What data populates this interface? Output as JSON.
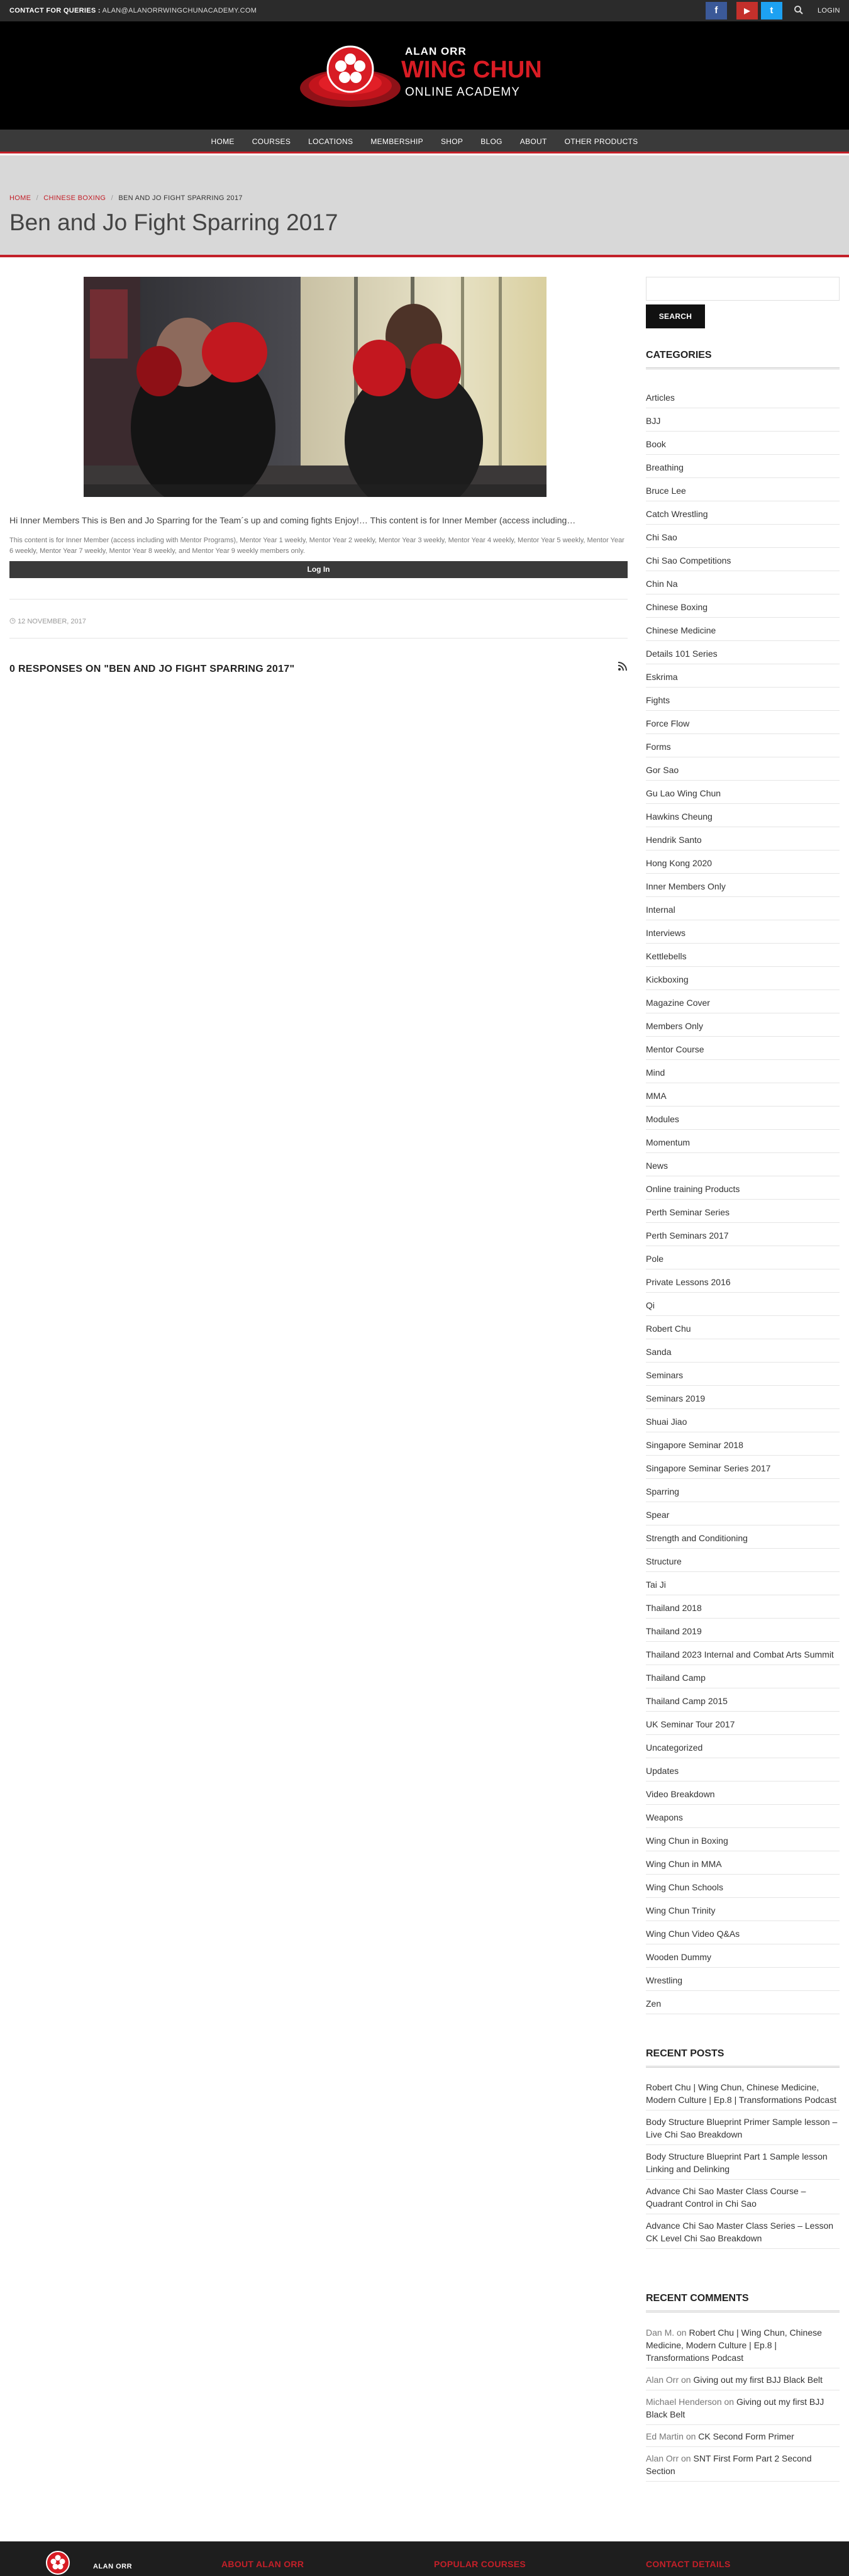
{
  "topbar": {
    "contact_label": "CONTACT FOR QUERIES :",
    "contact_email": "ALAN@ALANORRWINGCHUNACADEMY.COM",
    "facebook_glyph": "f",
    "youtube_glyph": "▶",
    "twitter_glyph": "t",
    "login_label": "LOGIN"
  },
  "logo": {
    "line1": "ALAN ORR",
    "line2": "WING CHUN",
    "line3": "ONLINE ACADEMY"
  },
  "nav": {
    "items": [
      "HOME",
      "COURSES",
      "LOCATIONS",
      "MEMBERSHIP",
      "SHOP",
      "BLOG",
      "ABOUT",
      "OTHER PRODUCTS"
    ]
  },
  "breadcrumb": {
    "home": "HOME",
    "category": "CHINESE BOXING",
    "current": "BEN AND JO FIGHT SPARRING 2017",
    "separator": "/"
  },
  "page_title": "Ben and Jo Fight Sparring 2017",
  "post": {
    "excerpt": "Hi Inner Members This is Ben and Jo Sparring for the Team´s up and coming fights Enjoy!… This content is for Inner Member (access including…",
    "notice": "This content is for Inner Member (access including with Mentor Programs), Mentor Year 1 weekly, Mentor Year 2 weekly, Mentor Year 3 weekly, Mentor Year 4 weekly, Mentor Year 5 weekly, Mentor Year 6 weekly, Mentor Year 7 weekly, Mentor Year 8 weekly, and Mentor Year 9 weekly members only.",
    "login_button": "Log In",
    "date": "12 NOVEMBER, 2017",
    "responses": "0 RESPONSES ON \"BEN AND JO FIGHT SPARRING 2017\""
  },
  "sidebar": {
    "search_placeholder": "",
    "search_button": "SEARCH",
    "categories_heading": "CATEGORIES",
    "categories": [
      "Articles",
      "BJJ",
      "Book",
      "Breathing",
      "Bruce Lee",
      "Catch Wrestling",
      "Chi Sao",
      "Chi Sao Competitions",
      "Chin Na",
      "Chinese Boxing",
      "Chinese Medicine",
      "Details 101 Series",
      "Eskrima",
      "Fights",
      "Force Flow",
      "Forms",
      "Gor Sao",
      "Gu Lao Wing Chun",
      "Hawkins Cheung",
      "Hendrik Santo",
      "Hong Kong 2020",
      "Inner Members Only",
      "Internal",
      "Interviews",
      "Kettlebells",
      "Kickboxing",
      "Magazine Cover",
      "Members Only",
      "Mentor Course",
      "Mind",
      "MMA",
      "Modules",
      "Momentum",
      "News",
      "Online training Products",
      "Perth Seminar Series",
      "Perth Seminars 2017",
      "Pole",
      "Private Lessons 2016",
      "Qi",
      "Robert Chu",
      "Sanda",
      "Seminars",
      "Seminars 2019",
      "Shuai Jiao",
      "Singapore Seminar 2018",
      "Singapore Seminar Series 2017",
      "Sparring",
      "Spear",
      "Strength and Conditioning",
      "Structure",
      "Tai Ji",
      "Thailand 2018",
      "Thailand 2019",
      "Thailand 2023 Internal and Combat Arts Summit",
      "Thailand Camp",
      "Thailand Camp 2015",
      "UK Seminar Tour 2017",
      "Uncategorized",
      "Updates",
      "Video Breakdown",
      "Weapons",
      "Wing Chun in Boxing",
      "Wing Chun in MMA",
      "Wing Chun Schools",
      "Wing Chun Trinity",
      "Wing Chun Video Q&As",
      "Wooden Dummy",
      "Wrestling",
      "Zen"
    ],
    "recent_posts_heading": "RECENT POSTS",
    "recent_posts": [
      "Robert Chu | Wing Chun, Chinese Medicine, Modern Culture | Ep.8 | Transformations Podcast",
      "Body Structure Blueprint Primer Sample lesson – Live Chi Sao Breakdown",
      "Body Structure Blueprint Part 1 Sample lesson Linking and Delinking",
      "Advance Chi Sao Master Class Course – Quadrant Control in Chi Sao",
      "Advance Chi Sao Master Class Series – Lesson CK Level Chi Sao Breakdown"
    ],
    "recent_comments_heading": "RECENT COMMENTS",
    "recent_comments": [
      {
        "author": "Dan M.",
        "on": "on",
        "post": "Robert Chu | Wing Chun, Chinese Medicine, Modern Culture | Ep.8 | Transformations Podcast"
      },
      {
        "author": "Alan Orr",
        "on": "on",
        "post": "Giving out my first BJJ Black Belt"
      },
      {
        "author": "Michael Henderson",
        "on": "on",
        "post": "Giving out my first BJJ Black Belt"
      },
      {
        "author": "Ed Martin",
        "on": "on",
        "post": "CK Second Form Primer"
      },
      {
        "author": "Alan Orr",
        "on": "on",
        "post": "SNT First Form Part 2 Second Section"
      }
    ]
  },
  "footer": {
    "logo_text": "ALAN ORR",
    "col1": "ABOUT ALAN ORR",
    "col2": "POPULAR COURSES",
    "col3": "CONTACT DETAILS"
  },
  "colors": {
    "accent_red": "#c32029",
    "dark_bar": "#3a3a3a",
    "topbar": "#2b2b2b"
  }
}
